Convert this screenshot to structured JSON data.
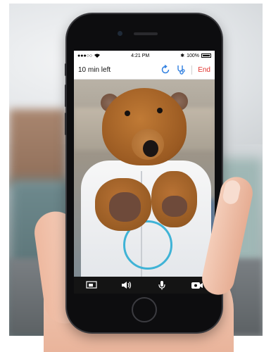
{
  "status_bar": {
    "signal": "●●●○○",
    "time": "4:21 PM",
    "bluetooth": "✱",
    "battery_percent": "100%"
  },
  "nav": {
    "time_left": "10 min left",
    "end_label": "End",
    "icons": [
      "refresh-icon",
      "stethoscope-icon"
    ]
  },
  "call_controls": {
    "icons": [
      "screen-share-icon",
      "speaker-icon",
      "microphone-icon",
      "switch-camera-icon"
    ]
  },
  "colors": {
    "end": "#e1322c",
    "accent": "#2f7fe0",
    "toolbar": "#141414",
    "stethoscope": "#3fb3d6"
  }
}
